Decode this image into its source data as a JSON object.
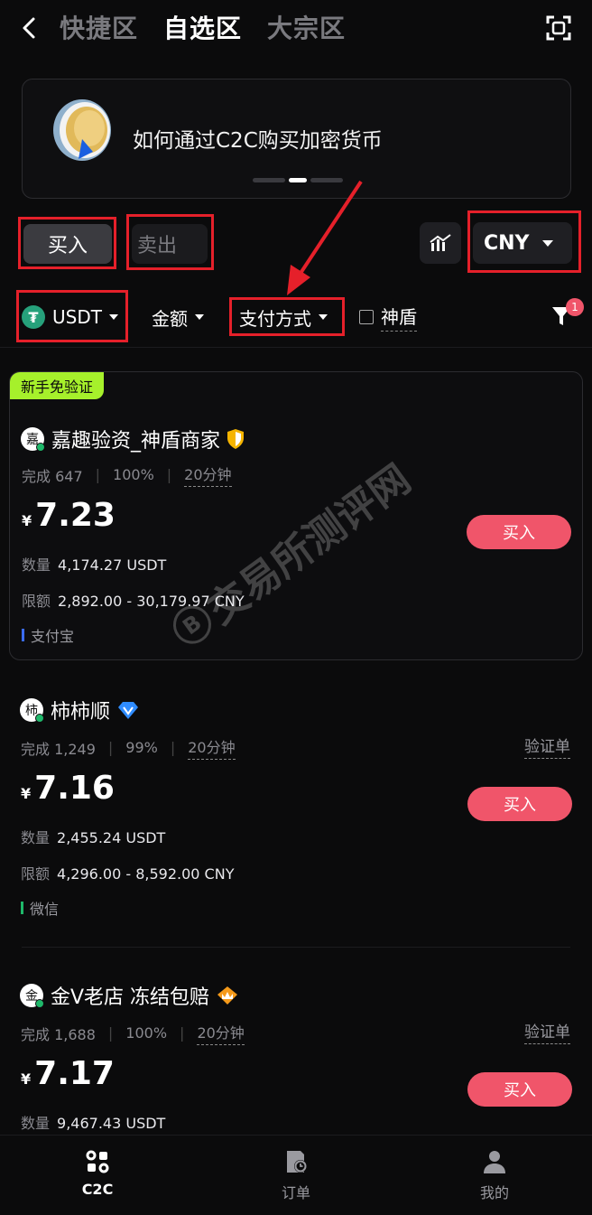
{
  "header": {
    "tabs": [
      {
        "label": "快捷区"
      },
      {
        "label": "自选区"
      },
      {
        "label": "大宗区"
      }
    ],
    "active_tab": "自选区"
  },
  "banner": {
    "text": "如何通过C2C购买加密货币"
  },
  "trade_toggle": {
    "buy_label": "买入",
    "sell_label": "卖出"
  },
  "currency": {
    "selected": "CNY"
  },
  "filters": {
    "coin": "USDT",
    "amount": "金额",
    "payment": "支付方式",
    "shield": "神盾",
    "filter_badge": "1"
  },
  "listings": [
    {
      "tag": "新手免验证",
      "merchant": "嘉趣验资_神盾商家",
      "avatar_char": "嘉",
      "badge": "shield-icon",
      "completed": "完成 647",
      "rate": "100%",
      "time": "20分钟",
      "price": "7.23",
      "currency_symbol": "¥",
      "quantity_label": "数量",
      "quantity": "4,174.27 USDT",
      "limit_label": "限额",
      "limit": "2,892.00 - 30,179.97 CNY",
      "payment": "支付宝",
      "payment_color": "#3b6cf5",
      "buy_label": "买入"
    },
    {
      "merchant": "柿柿顺",
      "avatar_char": "柿",
      "badge": "diamond-icon",
      "completed": "完成 1,249",
      "rate": "99%",
      "time": "20分钟",
      "verify_label": "验证单",
      "price": "7.16",
      "currency_symbol": "¥",
      "quantity_label": "数量",
      "quantity": "2,455.24 USDT",
      "limit_label": "限额",
      "limit": "4,296.00 - 8,592.00 CNY",
      "payment": "微信",
      "payment_color": "#1fb86a",
      "buy_label": "买入"
    },
    {
      "merchant": "金V老店 冻结包赔",
      "avatar_char": "金",
      "badge": "crown-icon",
      "completed": "完成 1,688",
      "rate": "100%",
      "time": "20分钟",
      "verify_label": "验证单",
      "price": "7.17",
      "currency_symbol": "¥",
      "quantity_label": "数量",
      "quantity": "9,467.43 USDT",
      "buy_label": "买入"
    }
  ],
  "watermark": {
    "text": "交易所测评网",
    "symbol": "B"
  },
  "bottom_nav": [
    {
      "label": "C2C",
      "icon": "c2c-icon"
    },
    {
      "label": "订单",
      "icon": "order-icon"
    },
    {
      "label": "我的",
      "icon": "profile-icon"
    }
  ],
  "colors": {
    "accent_red": "#f0556a",
    "tag_green": "#a6f02b",
    "annotation_red": "#e5202a",
    "background": "#0b0b0c"
  }
}
